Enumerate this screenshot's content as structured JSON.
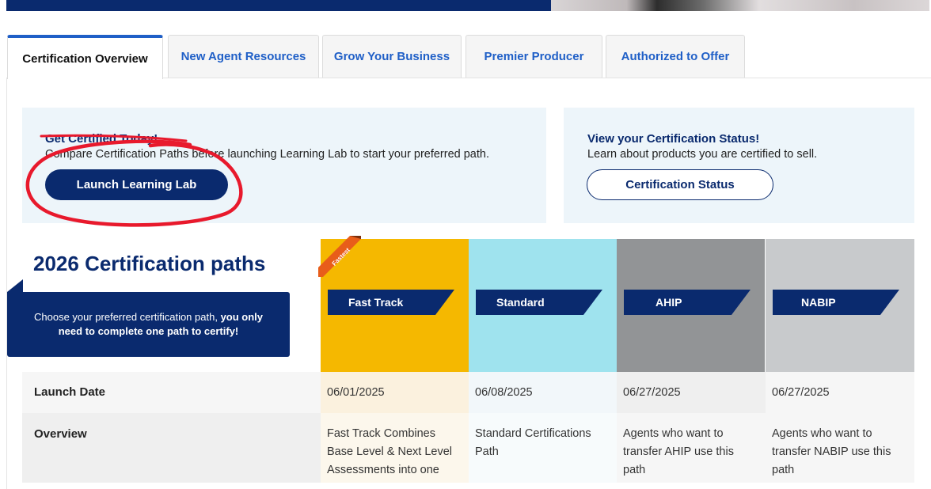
{
  "tabs": [
    {
      "label": "Certification Overview",
      "active": true
    },
    {
      "label": "New Agent Resources",
      "active": false
    },
    {
      "label": "Grow Your Business",
      "active": false
    },
    {
      "label": "Premier Producer",
      "active": false
    },
    {
      "label": "Authorized to Offer",
      "active": false
    }
  ],
  "promo_left": {
    "title": "Get Certified Today!",
    "text": "Compare Certification Paths before launching Learning Lab to start your preferred path.",
    "button": "Launch Learning Lab"
  },
  "promo_right": {
    "title": "View your Certification Status!",
    "text": "Learn about products you are certified to sell.",
    "button": "Certification Status"
  },
  "paths": {
    "heading": "2026 Certification paths",
    "note_plain": "Choose your preferred certification path, ",
    "note_bold": "you only need to complete one path to certify!",
    "badge": "Fastest",
    "columns": [
      {
        "name": "Fast Track",
        "color": "#f5b800",
        "launch": "06/01/2025",
        "overview": "Fast Track Combines Base Level & Next Level Assessments into one"
      },
      {
        "name": "Standard",
        "color": "#9fe3ee",
        "launch": "06/08/2025",
        "overview": "Standard Certifications Path"
      },
      {
        "name": "AHIP",
        "color": "#929496",
        "launch": "06/27/2025",
        "overview": "Agents who want to transfer AHIP use this path"
      },
      {
        "name": "NABIP",
        "color": "#c8cacc",
        "launch": "06/27/2025",
        "overview": "Agents who want to transfer NABIP use this path"
      }
    ],
    "rows": {
      "launch_label": "Launch Date",
      "overview_label": "Overview"
    }
  },
  "colors": {
    "navy": "#0a2a6e",
    "link_blue": "#1f5fc7",
    "annotation_red": "#e8192c"
  }
}
